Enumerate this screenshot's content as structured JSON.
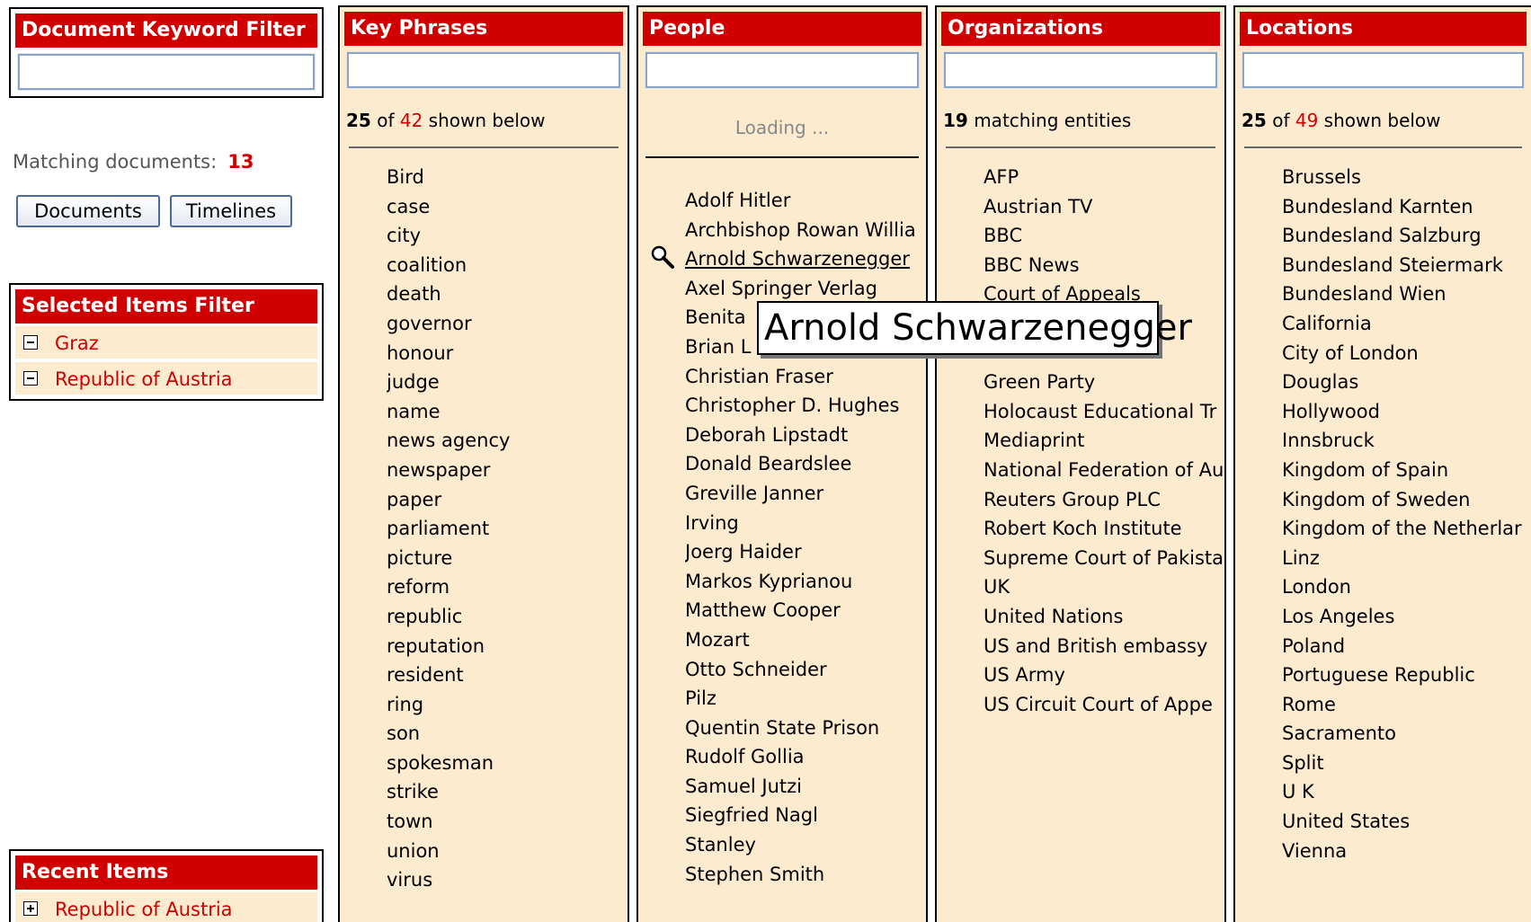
{
  "keyword_filter": {
    "title": "Document Keyword Filter",
    "value": ""
  },
  "matching": {
    "label": "Matching documents:",
    "count": "13"
  },
  "buttons": {
    "documents": "Documents",
    "timelines": "Timelines"
  },
  "selected_items": {
    "title": "Selected Items Filter",
    "items": [
      "Graz",
      "Republic of Austria"
    ]
  },
  "recent_items": {
    "title": "Recent Items",
    "items": [
      "Republic of Austria"
    ]
  },
  "key_phrases": {
    "title": "Key Phrases",
    "shown": "25",
    "of_word": "of",
    "total": "42",
    "suffix": "shown below",
    "items": [
      "Bird",
      "case",
      "city",
      "coalition",
      "death",
      "governor",
      "honour",
      "judge",
      "name",
      "news agency",
      "newspaper",
      "paper",
      "parliament",
      "picture",
      "reform",
      "republic",
      "reputation",
      "resident",
      "ring",
      "son",
      "spokesman",
      "strike",
      "town",
      "union",
      "virus"
    ]
  },
  "people": {
    "title": "People",
    "loading": "Loading ...",
    "items": [
      "Adolf Hitler",
      "Archbishop Rowan Willia",
      "Arnold Schwarzenegger",
      "Axel Springer Verlag",
      "Benita",
      "Brian L",
      "Christian Fraser",
      "Christopher D. Hughes",
      "Deborah Lipstadt",
      "Donald Beardslee",
      "Greville Janner",
      "Irving",
      "Joerg Haider",
      "Markos Kyprianou",
      "Matthew Cooper",
      "Mozart",
      "Otto Schneider",
      "Pilz",
      "Quentin State Prison",
      "Rudolf Gollia",
      "Samuel Jutzi",
      "Siegfried Nagl",
      "Stanley",
      "Stephen Smith"
    ],
    "hovered": "Arnold Schwarzenegger"
  },
  "organizations": {
    "title": "Organizations",
    "count": "19",
    "suffix": "matching entities",
    "items": [
      "AFP",
      "Austrian TV",
      "BBC",
      "BBC News",
      "Court of Appeals",
      "",
      "",
      "Green Party",
      "Holocaust Educational Tr",
      "Mediaprint",
      "National Federation of Au",
      "Reuters Group PLC",
      "Robert Koch Institute",
      "Supreme Court of Pakista",
      "UK",
      "United Nations",
      "US and British embassy",
      "US Army",
      "US Circuit Court of Appe"
    ]
  },
  "locations": {
    "title": "Locations",
    "shown": "25",
    "of_word": "of",
    "total": "49",
    "suffix": "shown below",
    "items": [
      "Brussels",
      "Bundesland Karnten",
      "Bundesland Salzburg",
      "Bundesland Steiermark",
      "Bundesland Wien",
      "California",
      "City of London",
      "Douglas",
      "Hollywood",
      "Innsbruck",
      "Kingdom of Spain",
      "Kingdom of Sweden",
      "Kingdom of the Netherlar",
      "Linz",
      "London",
      "Los Angeles",
      "Poland",
      "Portuguese Republic",
      "Rome",
      "Sacramento",
      "Split",
      "U K",
      "United States",
      "Vienna"
    ]
  },
  "tooltip": {
    "text": "Arnold Schwarzenegger"
  },
  "colors": {
    "header_red": "#d00000",
    "panel_bg": "#fdebd0",
    "accent_link": "#d00000"
  },
  "icons": {
    "hover_icon": "magnifier-icon",
    "collapse": "minus-box-icon",
    "expand": "plus-box-icon"
  }
}
